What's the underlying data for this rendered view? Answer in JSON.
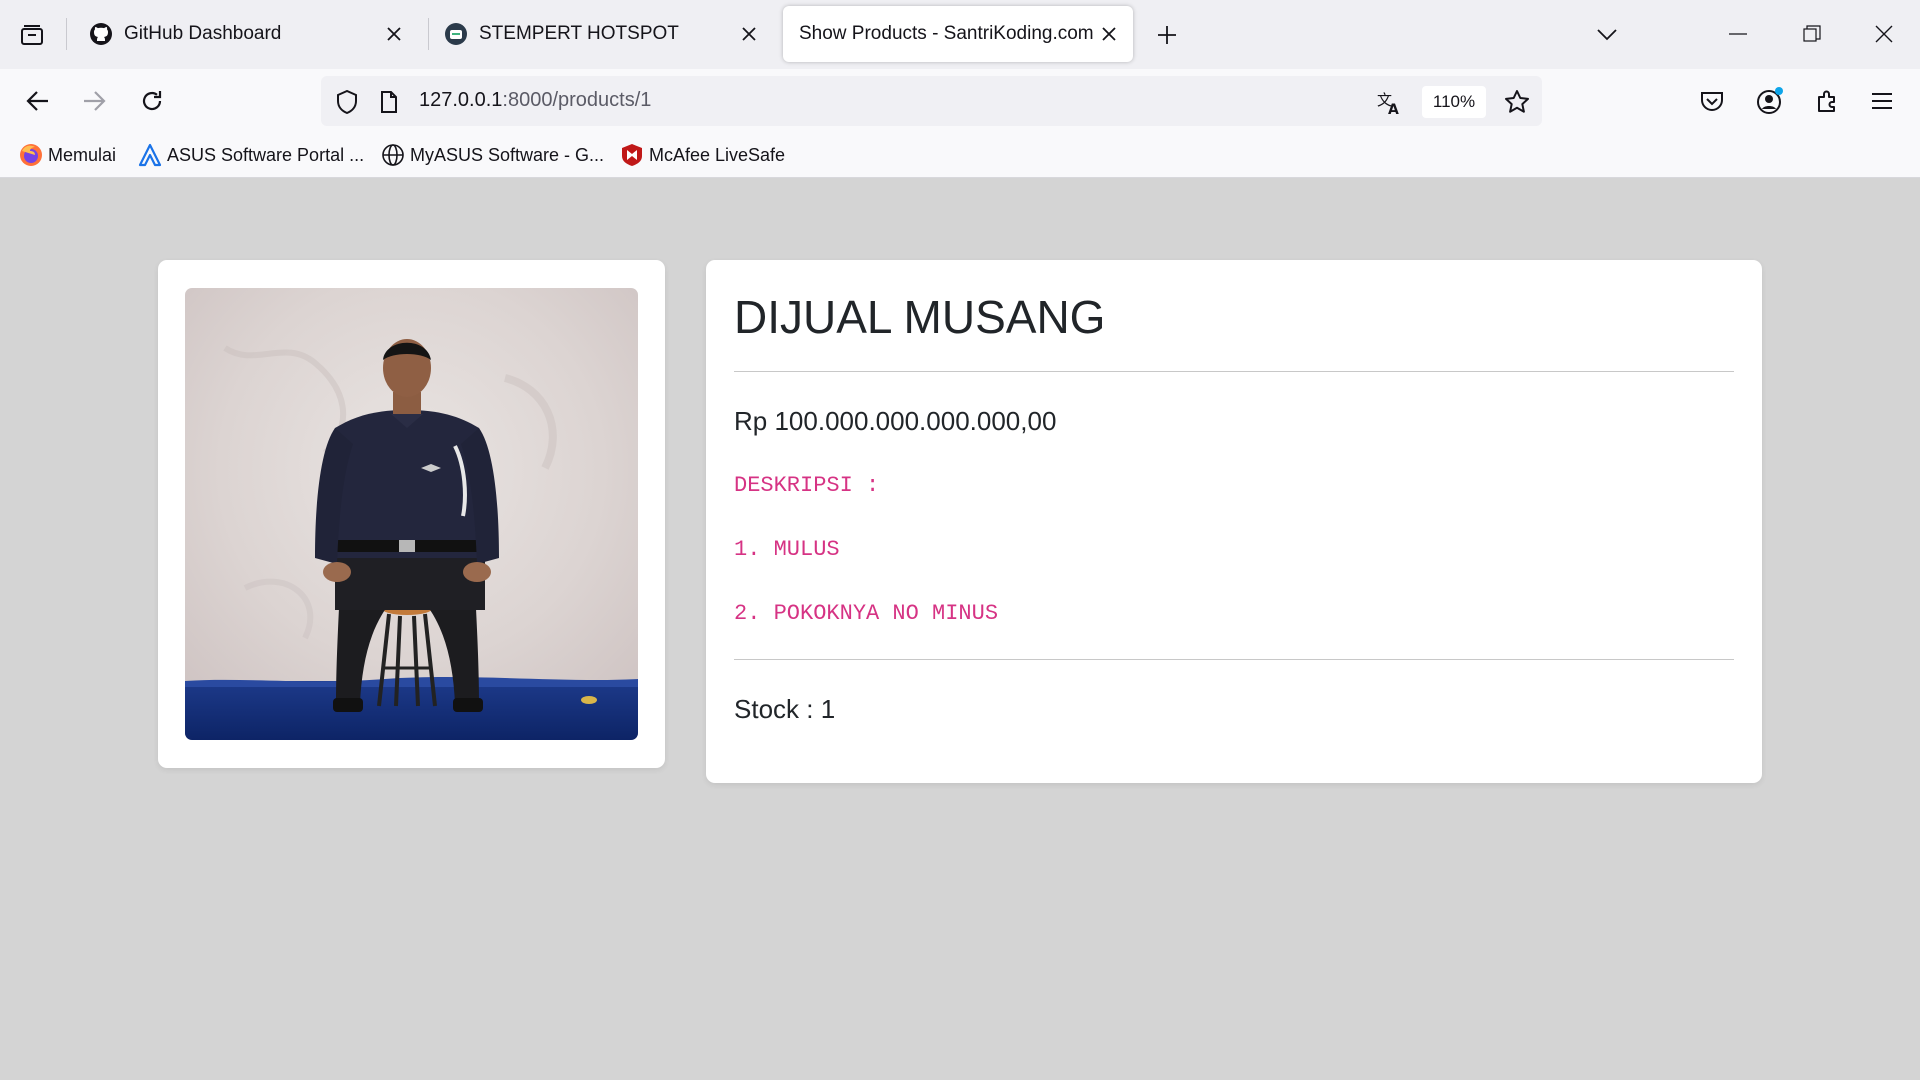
{
  "browser": {
    "tabs": [
      {
        "title": "GitHub Dashboard",
        "icon": "github-icon",
        "active": false
      },
      {
        "title": "STEMPERT HOTSPOT",
        "icon": "hotspot-icon",
        "active": false
      },
      {
        "title": "Show Products - SantriKoding.com",
        "icon": "",
        "active": true
      }
    ],
    "url_host": "127.0.0.1",
    "url_rest": ":8000/products/1",
    "zoom": "110%",
    "bookmarks": [
      {
        "label": "Memulai",
        "icon": "firefox-icon"
      },
      {
        "label": "ASUS Software Portal ...",
        "icon": "asus-icon"
      },
      {
        "label": "MyASUS Software - G...",
        "icon": "globe-icon"
      },
      {
        "label": "McAfee LiveSafe",
        "icon": "mcafee-icon"
      }
    ]
  },
  "product": {
    "title": "DIJUAL MUSANG",
    "price": "Rp 100.000.000.000.000,00",
    "description": [
      "DESKRIPSI :",
      "1. MULUS",
      "2. POKOKNYA NO MINUS"
    ],
    "stock": "Stock : 1",
    "image_icon": "product-photo"
  },
  "colors": {
    "page_bg": "#d4d4d4",
    "description_text": "#d63384",
    "tabstrip_bg": "#efeff3"
  }
}
